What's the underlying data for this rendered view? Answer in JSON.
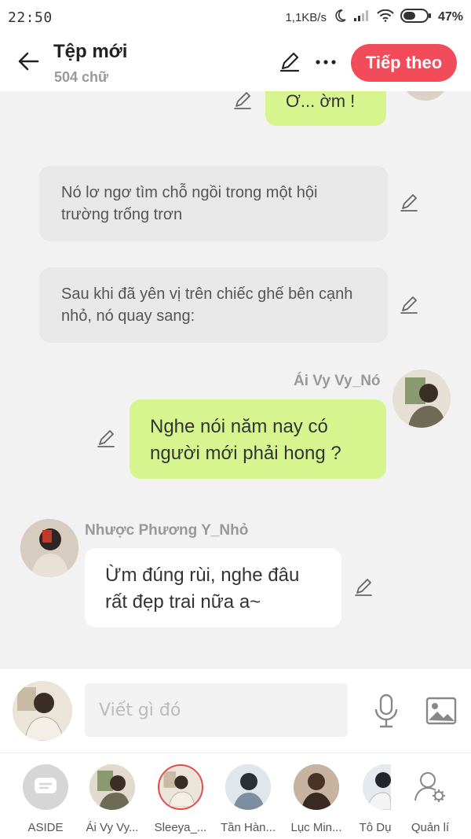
{
  "status_bar": {
    "time": "22:50",
    "network_speed": "1,1KB/s",
    "battery_percent": "47%"
  },
  "header": {
    "title": "Tệp mới",
    "word_count": "504 chữ",
    "next_label": "Tiếp theo",
    "accent_color": "#f24c5a"
  },
  "messages": {
    "partial_green": "Ơ... ờm !",
    "narration_1": "Nó lơ ngơ tìm chỗ ngồi trong một hội trường trống trơn",
    "narration_2": "Sau khi đã yên vị trên chiếc ghế bên cạnh nhỏ, nó quay sang:",
    "right_sender": "Ái Vy Vy_Nó",
    "right_text": "Nghe nói năm nay có người mới phải hong ?",
    "left_sender": "Nhược Phương Y_Nhỏ",
    "left_text": "Ừm đúng rùi, nghe đâu rất đẹp trai nữa a~"
  },
  "composer": {
    "placeholder": "Viết gì đó"
  },
  "characters": [
    {
      "label": "ASIDE"
    },
    {
      "label": "Ái Vy Vy..."
    },
    {
      "label": "Sleeya_..."
    },
    {
      "label": "Tần Hàn..."
    },
    {
      "label": "Lục Min..."
    },
    {
      "label": "Tô Dụ"
    },
    {
      "label": "Quản lí"
    }
  ]
}
